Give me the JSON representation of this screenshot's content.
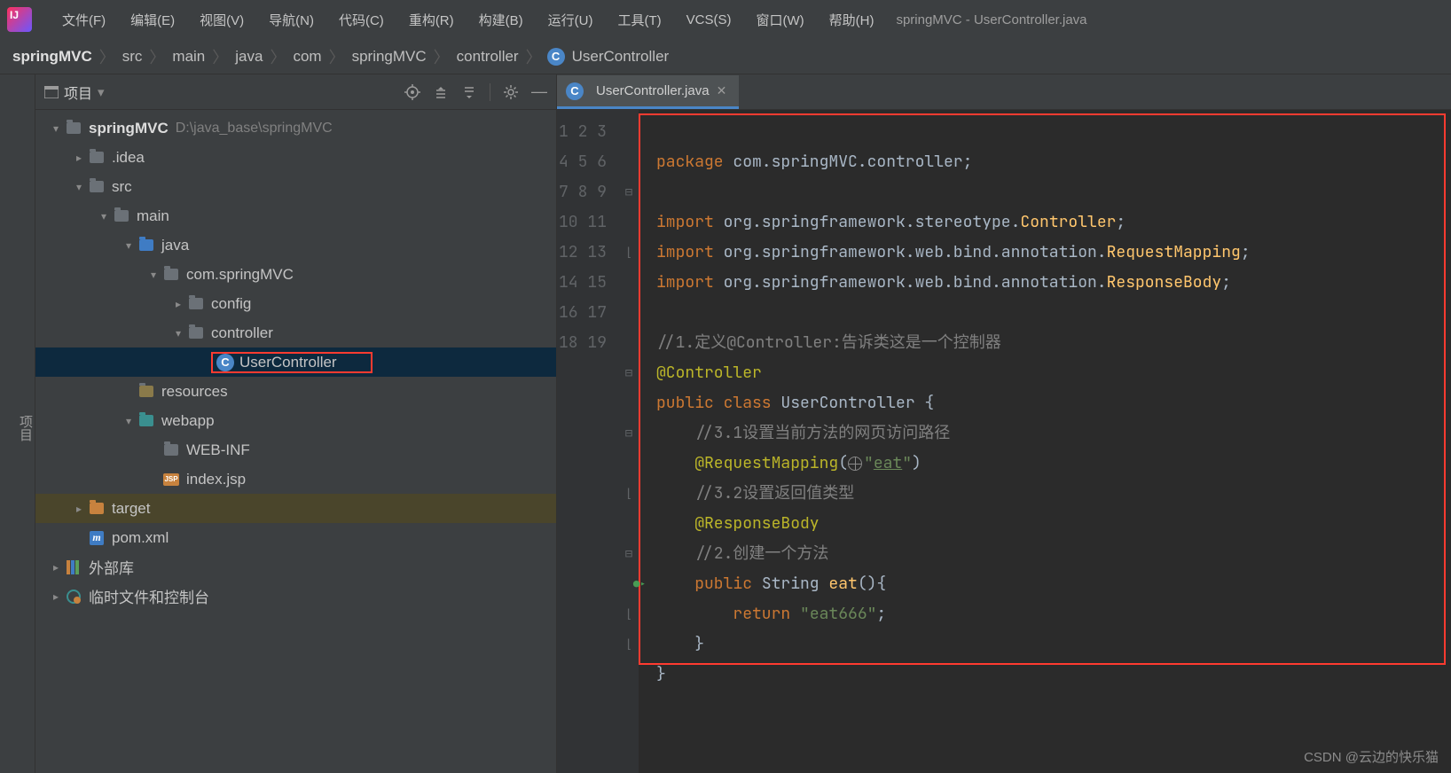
{
  "window_title": "springMVC - UserController.java",
  "menu": [
    "文件(F)",
    "编辑(E)",
    "视图(V)",
    "导航(N)",
    "代码(C)",
    "重构(R)",
    "构建(B)",
    "运行(U)",
    "工具(T)",
    "VCS(S)",
    "窗口(W)",
    "帮助(H)"
  ],
  "breadcrumb": [
    "springMVC",
    "src",
    "main",
    "java",
    "com",
    "springMVC",
    "controller",
    "UserController"
  ],
  "sidebar": {
    "panel_title": "项目",
    "gutter_label": "项目",
    "root_name": "springMVC",
    "root_path": "D:\\java_base\\springMVC",
    "nodes": {
      "idea": ".idea",
      "src": "src",
      "main": "main",
      "java": "java",
      "pkg": "com.springMVC",
      "config": "config",
      "controller": "controller",
      "user_controller": "UserController",
      "resources": "resources",
      "webapp": "webapp",
      "webinf": "WEB-INF",
      "indexjsp": "index.jsp",
      "target": "target",
      "pom": "pom.xml",
      "ext_lib": "外部库",
      "scratch": "临时文件和控制台"
    }
  },
  "tab": {
    "label": "UserController.java"
  },
  "code": {
    "lines": [
      "1",
      "2",
      "3",
      "4",
      "5",
      "6",
      "7",
      "8",
      "9",
      "10",
      "11",
      "12",
      "13",
      "14",
      "15",
      "16",
      "17",
      "18",
      "19"
    ],
    "pkg_kw": "package ",
    "pkg_val": "com.springMVC.controller",
    "imp_kw": "import ",
    "imp1a": "org.springframework.stereotype.",
    "imp1b": "Controller",
    "imp2a": "org.springframework.web.bind.annotation.",
    "imp2b": "RequestMapping",
    "imp3a": "org.springframework.web.bind.annotation.",
    "imp3b": "ResponseBody",
    "c1": "//1.定义@Controller:告诉类这是一个控制器",
    "ann_ctrl": "@Controller",
    "pub": "public ",
    "cls_kw": "class ",
    "cls_name": "UserController ",
    "lb": "{",
    "c31": "//3.1设置当前方法的网页访问路径",
    "ann_rm": "@RequestMapping",
    "rm_open": "(",
    "rm_val": "eat",
    "rm_close": ")",
    "c32": "//3.2设置返回值类型",
    "ann_rb": "@ResponseBody",
    "c2": "//2.创建一个方法",
    "m_sig_pub": "public ",
    "m_sig_type": "String ",
    "m_sig_name": "eat",
    "m_sig_rest": "(){",
    "ret_kw": "return ",
    "ret_val": "\"eat666\"",
    "semi": ";",
    "rb": "}",
    "rb2": "}"
  },
  "watermark": "CSDN @云边的快乐猫"
}
